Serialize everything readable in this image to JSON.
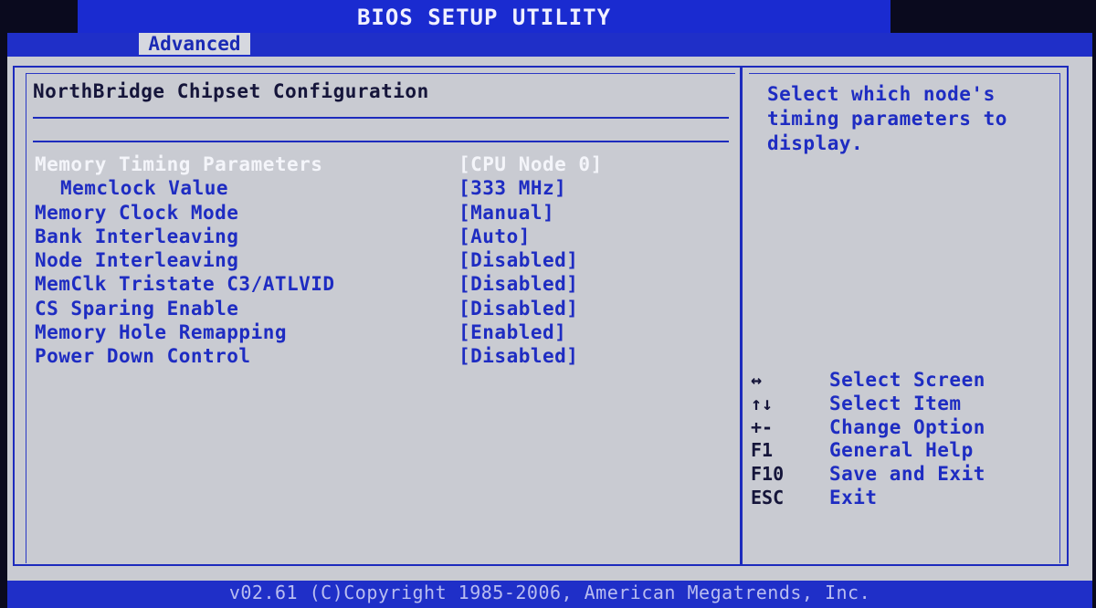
{
  "title": "BIOS SETUP UTILITY",
  "tabs": [
    {
      "label": "Advanced",
      "active": true
    }
  ],
  "page_title": "NorthBridge Chipset Configuration",
  "settings": [
    {
      "label": "Memory Timing Parameters",
      "value": "[CPU Node 0]",
      "selected": true
    },
    {
      "label": "Memclock Value",
      "value": "[333 MHz]",
      "indent": true
    },
    {
      "label": "Memory Clock Mode",
      "value": "[Manual]"
    },
    {
      "label": "Bank Interleaving",
      "value": "[Auto]"
    },
    {
      "label": "Node Interleaving",
      "value": "[Disabled]"
    },
    {
      "label": "MemClk Tristate C3/ATLVID",
      "value": "[Disabled]"
    },
    {
      "label": "CS Sparing Enable",
      "value": "[Disabled]"
    },
    {
      "label": "Memory Hole Remapping",
      "value": "[Enabled]"
    },
    {
      "label": "Power Down Control",
      "value": "[Disabled]"
    }
  ],
  "help_text": "Select which node's timing parameters to display.",
  "key_legend": [
    {
      "key": "↔",
      "desc": "Select Screen",
      "icon": "left-right-arrows-icon"
    },
    {
      "key": "↑↓",
      "desc": "Select Item",
      "icon": "up-down-arrows-icon"
    },
    {
      "key": "+-",
      "desc": "Change Option",
      "icon": "plus-minus-icon"
    },
    {
      "key": "F1",
      "desc": "General Help"
    },
    {
      "key": "F10",
      "desc": "Save and Exit"
    },
    {
      "key": "ESC",
      "desc": "Exit"
    }
  ],
  "footer": "v02.61 (C)Copyright 1985-2006, American Megatrends, Inc.",
  "colors": {
    "blue_bar": "#1f2fc8",
    "panel_bg": "#c9cbd2",
    "text_blue": "#1e2cc2",
    "selected_text": "#f4f5fa"
  }
}
